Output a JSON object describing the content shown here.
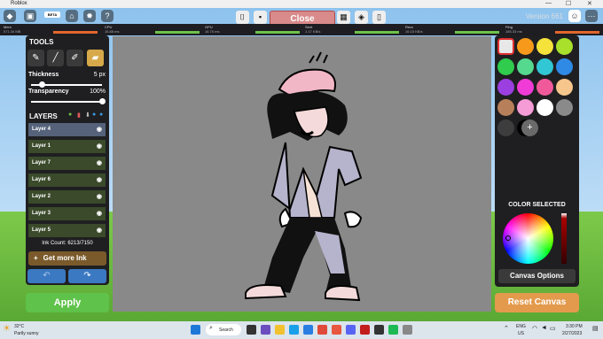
{
  "window": {
    "title": "Roblox",
    "controls": [
      "—",
      "☐",
      "✕"
    ]
  },
  "top": {
    "beta": "BETA",
    "close": "Close",
    "version": "Version 661"
  },
  "stats": [
    {
      "name": "Mem",
      "value": "571.34 MB"
    },
    {
      "name": "CPU",
      "value": "16.88 ms"
    },
    {
      "name": "GPU",
      "value": "16.75 ms"
    },
    {
      "name": "Sent",
      "value": "1.17 KB/s"
    },
    {
      "name": "Recv",
      "value": "16.15 KB/s"
    },
    {
      "name": "Ping",
      "value": "185.33 ms"
    }
  ],
  "tools": {
    "header": "TOOLS",
    "thickness_label": "Thickness",
    "thickness_value": "5 px",
    "thickness_level": 0.15,
    "transparency_label": "Transparency",
    "transparency_value": "100%",
    "transparency_level": 1.0
  },
  "layers": {
    "header": "LAYERS",
    "items": [
      "Layer 4",
      "Layer 1",
      "Layer 7",
      "Layer 6",
      "Layer 2",
      "Layer 3",
      "Layer 5"
    ],
    "ink_count": "Ink Count: 6213/7150",
    "get_more_ink": "Get more Ink"
  },
  "apply": "Apply",
  "colors": {
    "palette": [
      "#e8e8e8",
      "#f79a1b",
      "#f5e23b",
      "#a8e02c",
      "#2fcc4d",
      "#55d98f",
      "#31c7d4",
      "#2f8ae6",
      "#9b3fe0",
      "#f03bd6",
      "#f05a9b",
      "#f7c68c",
      "#b8805a",
      "#f59bd6",
      "#ffffff",
      "#8a8a8a",
      "#3d3d3d",
      "#000000"
    ],
    "add": "+",
    "color_selected": "COLOR SELECTED",
    "canvas_options": "Canvas Options"
  },
  "reset_canvas": "Reset Canvas",
  "taskbar": {
    "weather_temp": "32°C",
    "weather_desc": "Partly sunny",
    "search": "Search",
    "lang1": "ENG",
    "lang2": "US",
    "time": "3:30 PM",
    "date": "2/27/2023"
  }
}
